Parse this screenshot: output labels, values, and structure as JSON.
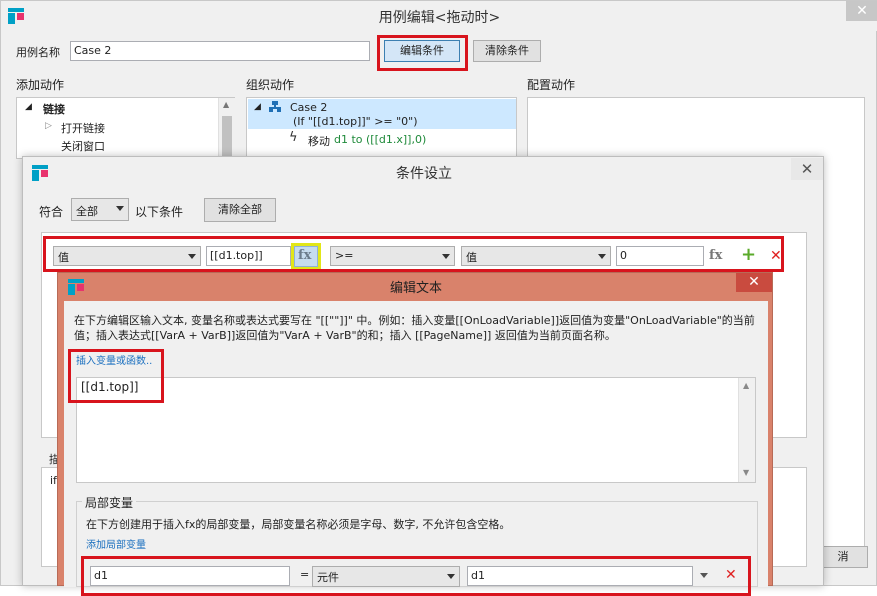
{
  "case_editor": {
    "title": "用例编辑<拖动时>",
    "case_name_label": "用例名称",
    "case_name_value": "Case 2",
    "edit_condition_button": "编辑条件",
    "clear_condition_button": "清除条件",
    "add_actions_heading": "添加动作",
    "organize_actions_heading": "组织动作",
    "configure_actions_heading": "配置动作",
    "add_actions_tree": {
      "group_label": "链接",
      "items": [
        "打开链接",
        "关闭窗口"
      ]
    },
    "organize_tree": {
      "case_label": "Case 2",
      "condition_text": "(If \"[[d1.top]]\" >= \"0\")",
      "action_prefix": "移动",
      "action_text": "d1 to ([[d1.x]],0)"
    },
    "cancel_button_fragment": "消",
    "close_glyph": "✕"
  },
  "condition_dialog": {
    "title": "条件设立",
    "match_label": "符合",
    "match_value": "全部",
    "match_suffix": "以下条件",
    "clear_all_button": "清除全部",
    "row": {
      "left_type": "值",
      "left_value": "[[d1.top]]",
      "fx_label": "fx",
      "operator": ">=",
      "right_type": "值",
      "right_value": "0",
      "fx2_label": "fx",
      "add_glyph": "+",
      "remove_glyph": "✕"
    },
    "desc_fragment_1": "描",
    "desc_fragment_2": "if",
    "close_glyph": "✕"
  },
  "edit_text_dialog": {
    "title": "编辑文本",
    "instructions": "在下方编辑区输入文本, 变量名称或表达式要写在 \"[[\"\"]]\" 中。例如：插入变量[[OnLoadVariable]]返回值为变量\"OnLoadVariable\"的当前值；插入表达式[[VarA + VarB]]返回值为\"VarA + VarB\"的和；插入 [[PageName]] 返回值为当前页面名称。",
    "insert_variable_link": "插入变量或函数..",
    "editor_text": "[[d1.top]]",
    "local_vars_heading": "局部变量",
    "local_vars_desc": "在下方创建用于插入fx的局部变量，局部变量名称必须是字母、数字, 不允许包含空格。",
    "add_local_var_link": "添加局部变量",
    "local_var": {
      "name": "d1",
      "equals": "=",
      "type": "元件",
      "target": "d1",
      "remove_glyph": "✕"
    },
    "close_glyph": "✕"
  },
  "colors": {
    "highlight_red": "#d8141d",
    "highlight_yellow": "#e2e617",
    "dialog_border": "#d9826b",
    "link_blue": "#1a6fbf"
  }
}
